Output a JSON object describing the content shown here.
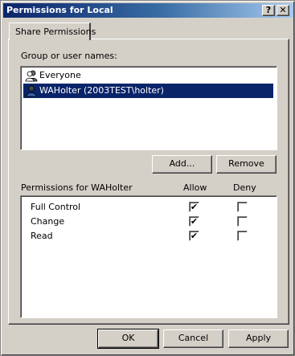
{
  "window": {
    "title": "Permissions for Local",
    "help_glyph": "?",
    "close_glyph": "✕"
  },
  "tabs": [
    {
      "label": "Share Permissions",
      "active": true
    }
  ],
  "group_section": {
    "label": "Group or user names:",
    "items": [
      {
        "name": "Everyone",
        "icon": "users-group-icon",
        "selected": false
      },
      {
        "name": "WAHolter (2003TEST\\holter)",
        "icon": "user-icon",
        "selected": true
      }
    ],
    "add_button": "Add...",
    "remove_button": "Remove"
  },
  "permissions_section": {
    "label": "Permissions for WAHolter",
    "allow_header": "Allow",
    "deny_header": "Deny",
    "rows": [
      {
        "name": "Full Control",
        "allow": true,
        "deny": false
      },
      {
        "name": "Change",
        "allow": true,
        "deny": false
      },
      {
        "name": "Read",
        "allow": true,
        "deny": false
      }
    ]
  },
  "footer": {
    "ok": "OK",
    "cancel": "Cancel",
    "apply": "Apply"
  },
  "check_glyph": "✔",
  "colors": {
    "title_active": "#0a246a",
    "selection": "#0a246a",
    "face": "#d4d0c8"
  }
}
